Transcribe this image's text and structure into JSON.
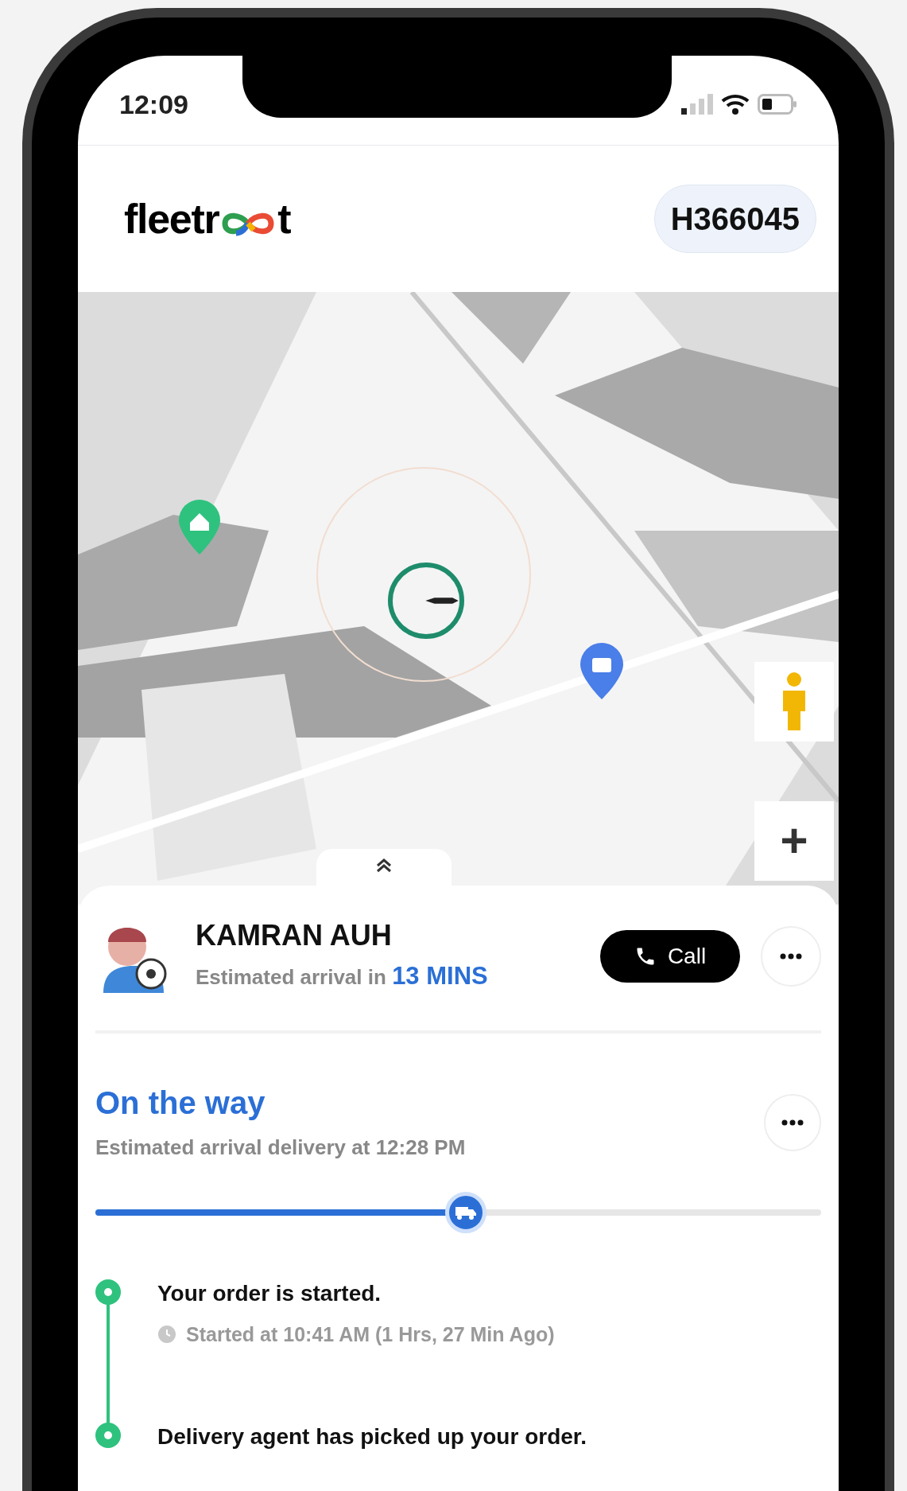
{
  "status_bar": {
    "time": "12:09"
  },
  "header": {
    "logo_start": "fleetr",
    "logo_end": "t",
    "order_id": "H366045"
  },
  "map": {
    "zoom_in": "+"
  },
  "driver": {
    "name": "KAMRAN AUH",
    "eta_prefix": "Estimated arrival in",
    "eta": "13 MINS",
    "call": "Call"
  },
  "status": {
    "title": "On the way",
    "subtitle": "Estimated arrival delivery at 12:28 PM",
    "progress": {
      "level": 0.51
    }
  },
  "timeline": [
    {
      "title": "Your order is started.",
      "detail": "Started at 10:41 AM (1 Hrs, 27 Min Ago)",
      "done": true
    },
    {
      "title": "Delivery agent has picked up your order.",
      "done": true
    }
  ]
}
